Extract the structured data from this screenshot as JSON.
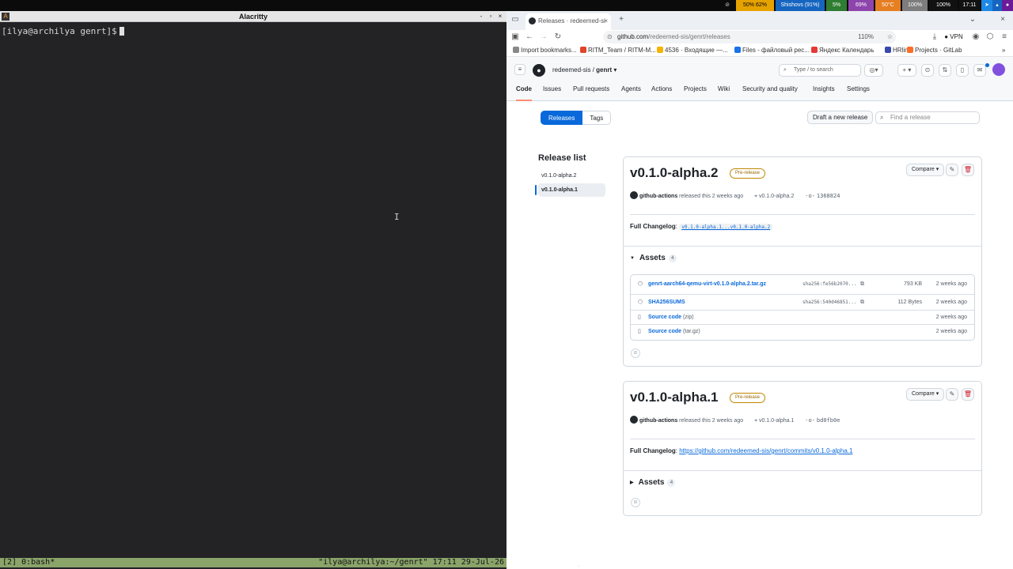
{
  "sysbar": {
    "segments": [
      {
        "text": "50% 62%",
        "color": "#e6a300",
        "fg": "#000"
      },
      {
        "text": "Shishovs (91%)",
        "color": "#1565c0",
        "fg": "#fff"
      },
      {
        "text": "5%",
        "color": "#2e7d32",
        "fg": "#fff"
      },
      {
        "text": "69%",
        "color": "#8e44ad",
        "fg": "#fff"
      },
      {
        "text": "50°C",
        "color": "#e67e22",
        "fg": "#fff"
      },
      {
        "text": "100%",
        "color": "#7d7d7d",
        "fg": "#fff"
      },
      {
        "text": "100%",
        "color": "#111",
        "fg": "#fff"
      },
      {
        "text": "17:11",
        "color": "#111",
        "fg": "#fff"
      }
    ]
  },
  "terminal": {
    "title": "Alacritty",
    "prompt": "[ilya@archilya genrt]$",
    "ibeam": "I",
    "status_left": "[2] 0:bash*",
    "status_right": "\"ilya@archilya:~/genrt\" 17:11 29-Jul-26",
    "win_buttons": [
      "-",
      "▫",
      "×"
    ]
  },
  "browser": {
    "tab_title": "Releases · redeemed-si",
    "tab_close": "×",
    "new_tab": "+",
    "url_host": "github.com",
    "url_path": "/redeemed-sis/genrt/releases",
    "zoom": "110%",
    "vpn": "VPN",
    "bookmarks": [
      {
        "label": "Import bookmarks...",
        "color": "#888"
      },
      {
        "label": "RITM_Team / RITM-M...",
        "color": "#e24329"
      },
      {
        "label": "4536 · Входящие —...",
        "color": "#f4b400"
      },
      {
        "label": "Files - файловый рес...",
        "color": "#1a73e8"
      },
      {
        "label": "Яндекс Календарь",
        "color": "#e53935"
      },
      {
        "label": "HRlink",
        "color": "#3949ab"
      },
      {
        "label": "Projects · GitLab",
        "color": "#fc6d26"
      }
    ]
  },
  "github": {
    "owner": "redeemed-sis",
    "repo": "genrt",
    "search_placeholder": "Type / to search",
    "tabs": [
      "Code",
      "Issues",
      "Pull requests",
      "Agents",
      "Actions",
      "Projects",
      "Wiki",
      "Security and quality",
      "Insights",
      "Settings"
    ],
    "seg_releases": "Releases",
    "seg_tags": "Tags",
    "draft_button": "Draft a new release",
    "find_placeholder": "Find a release",
    "release_list_title": "Release list",
    "release_list": [
      "v0.1.0-alpha.2",
      "v0.1.0-alpha.1"
    ],
    "releases": [
      {
        "title": "v0.1.0-alpha.2",
        "badge": "Pre-release",
        "compare": "Compare",
        "author": "github-actions",
        "released": "released this 2 weeks ago",
        "tag": "v0.1.0-alpha.2",
        "commit": "1368824",
        "changelog_label": "Full Changelog",
        "changelog_link": "v0.1.0-alpha.1...v0.1.0-alpha.2",
        "assets_label": "Assets",
        "assets_count": "4",
        "assets": [
          {
            "name": "genrt-aarch64-qemu-virt-v0.1.0-alpha.2.tar.gz",
            "suffix": "",
            "sha": "sha256:fe56b2070...",
            "size": "793 KB",
            "date": "2 weeks ago"
          },
          {
            "name": "SHA256SUMS",
            "suffix": "",
            "sha": "sha256:540d46851...",
            "size": "112 Bytes",
            "date": "2 weeks ago"
          },
          {
            "name": "Source code",
            "suffix": "(zip)",
            "sha": "",
            "size": "",
            "date": "2 weeks ago"
          },
          {
            "name": "Source code",
            "suffix": "(tar.gz)",
            "sha": "",
            "size": "",
            "date": "2 weeks ago"
          }
        ]
      },
      {
        "title": "v0.1.0-alpha.1",
        "badge": "Pre-release",
        "compare": "Compare",
        "author": "github-actions",
        "released": "released this 2 weeks ago",
        "tag": "v0.1.0-alpha.1",
        "commit": "bd0fb0e",
        "changelog_label": "Full Changelog",
        "changelog_link": "https://github.com/redeemed-sis/genrt/commits/v0.1.0-alpha.1",
        "assets_label": "Assets",
        "assets_count": "4"
      }
    ]
  }
}
